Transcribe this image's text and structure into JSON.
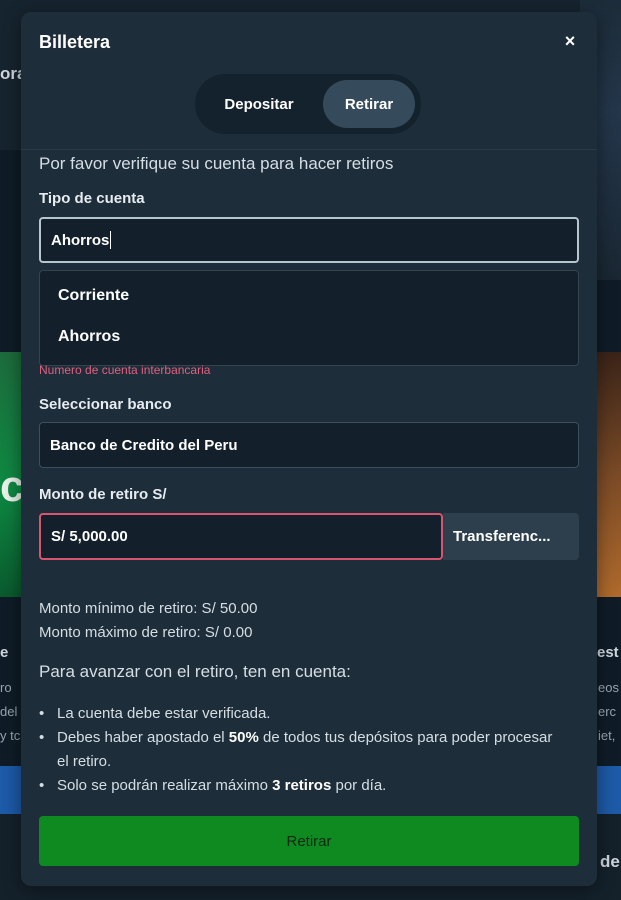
{
  "background": {
    "left_top_text": "ora",
    "left_mid_text": "c",
    "left_lower_text": "e",
    "left_snippets": [
      "ro",
      "del",
      "y tc"
    ],
    "right_lower_text": "est",
    "right_snippets": [
      "eos",
      "erc",
      "iet,"
    ],
    "right_bottom_text": "de"
  },
  "modal": {
    "title": "Billetera",
    "close_label": "×",
    "tabs": [
      {
        "label": "Depositar",
        "active": false
      },
      {
        "label": "Retirar",
        "active": true
      }
    ],
    "verify_message": "Por favor verifique su cuenta para hacer retiros",
    "account_type": {
      "label": "Tipo de cuenta",
      "value": "Ahorros",
      "options": [
        "Corriente",
        "Ahorros"
      ]
    },
    "interbank_error": "Numero de cuenta interbancaria",
    "bank": {
      "label": "Seleccionar banco",
      "value": "Banco de Credito del Peru"
    },
    "amount": {
      "label": "Monto de retiro S/",
      "value": "S/ 5,000.00",
      "method": "Transferenc..."
    },
    "limits": {
      "min": "Monto mínimo de retiro: S/ 50.00",
      "max": "Monto máximo de retiro: S/ 0.00"
    },
    "notice_title": "Para avanzar con el retiro, ten en cuenta:",
    "rules": [
      {
        "before": "La cuenta debe estar verificada.",
        "bold": "",
        "after": ""
      },
      {
        "before": "Debes haber apostado el ",
        "bold": "50%",
        "after": " de todos tus depósitos para poder procesar el retiro."
      },
      {
        "before": "Solo se podrán realizar máximo ",
        "bold": "3 retiros",
        "after": " por día."
      }
    ],
    "submit_label": "Retirar"
  },
  "colors": {
    "modal_bg": "#1d2d39",
    "accent_green": "#0e8a21",
    "error_pink": "#e0607e"
  }
}
